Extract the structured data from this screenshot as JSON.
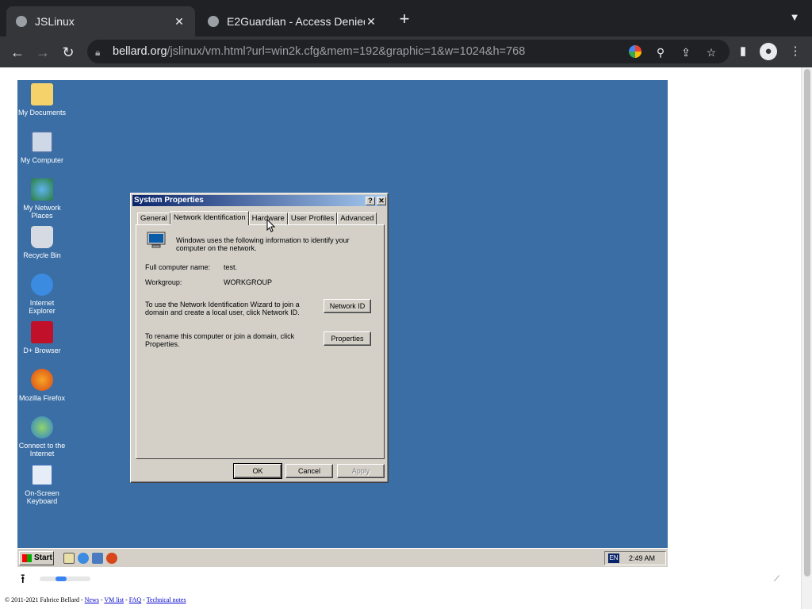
{
  "browser": {
    "tabs": [
      {
        "title": "JSLinux",
        "active": true
      },
      {
        "title": "E2Guardian - Access Denied",
        "active": false
      }
    ],
    "url_host": "bellard.org",
    "url_path": "/jslinux/vm.html?url=win2k.cfg&mem=192&graphic=1&w=1024&h=768"
  },
  "desktop": {
    "icons": [
      {
        "label": "My Documents",
        "icon": "folder-icon"
      },
      {
        "label": "My Computer",
        "icon": "computer-icon"
      },
      {
        "label": "My Network Places",
        "icon": "network-icon"
      },
      {
        "label": "Recycle Bin",
        "icon": "recycle-bin-icon"
      },
      {
        "label": "Internet Explorer",
        "icon": "ie-icon"
      },
      {
        "label": "D+ Browser",
        "icon": "dplus-icon"
      },
      {
        "label": "Mozilla Firefox",
        "icon": "firefox-icon"
      },
      {
        "label": "Connect to the Internet",
        "icon": "connect-icon"
      },
      {
        "label": "On-Screen Keyboard",
        "icon": "keyboard-icon"
      }
    ]
  },
  "dialog": {
    "title": "System Properties",
    "help_btn": "?",
    "close_btn": "✕",
    "tabs": [
      "General",
      "Network Identification",
      "Hardware",
      "User Profiles",
      "Advanced"
    ],
    "intro": "Windows uses the following information to identify your computer on the network.",
    "full_name_label": "Full computer name:",
    "full_name_value": "test.",
    "workgroup_label": "Workgroup:",
    "workgroup_value": "WORKGROUP",
    "network_id_text": "To use the Network Identification Wizard to join a domain and create a local user, click Network ID.",
    "network_id_btn": "Network ID",
    "rename_text": "To rename this computer or join a domain, click Properties.",
    "properties_btn": "Properties",
    "ok_btn": "OK",
    "cancel_btn": "Cancel",
    "apply_btn": "Apply"
  },
  "taskbar": {
    "start_label": "Start",
    "lang": "EN",
    "clock": "2:49 AM"
  },
  "footer": {
    "copyright": "© 2011-2021 Fabrice Bellard - ",
    "links": [
      "News",
      "VM list",
      "FAQ",
      "Technical notes"
    ]
  }
}
